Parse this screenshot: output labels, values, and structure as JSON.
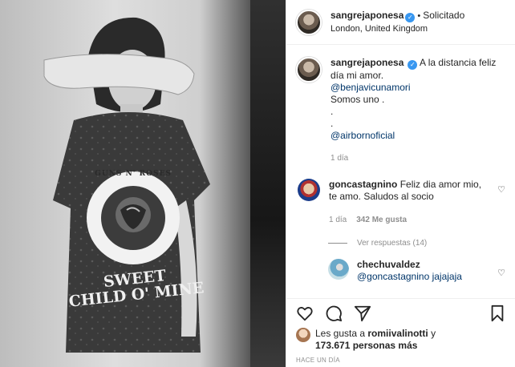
{
  "post": {
    "username": "sangrejaponesa",
    "follow_status": "Solicitado",
    "separator": "•",
    "location": "London, United Kingdom",
    "photo_shirt_text": [
      "GUNS N' ROSES",
      "SWEET",
      "CHILD O' MINE"
    ]
  },
  "caption": {
    "username": "sangrejaponesa",
    "lines": [
      "A la distancia feliz día mi amor.",
      "@benjavicunamori",
      "Somos uno .",
      ".",
      ".",
      "@airbornoficial"
    ],
    "time": "1 día"
  },
  "comment": {
    "username": "goncastagnino",
    "text": "Feliz dia amor mio, te amo. Saludos al socio",
    "time": "1 día",
    "likes": "342 Me gusta",
    "view_replies": "Ver respuestas (14)"
  },
  "reply": {
    "username": "chechuvaldez",
    "text": "@goncastagnino jajajaja"
  },
  "likes": {
    "prefix": "Les gusta a ",
    "user": "romiivalinotti",
    "connector": " y",
    "count": "173.671 personas más"
  },
  "timestamp": "HACE UN DÍA",
  "icons": [
    "heart-icon",
    "comment-icon",
    "share-icon",
    "bookmark-icon",
    "verified-icon"
  ]
}
